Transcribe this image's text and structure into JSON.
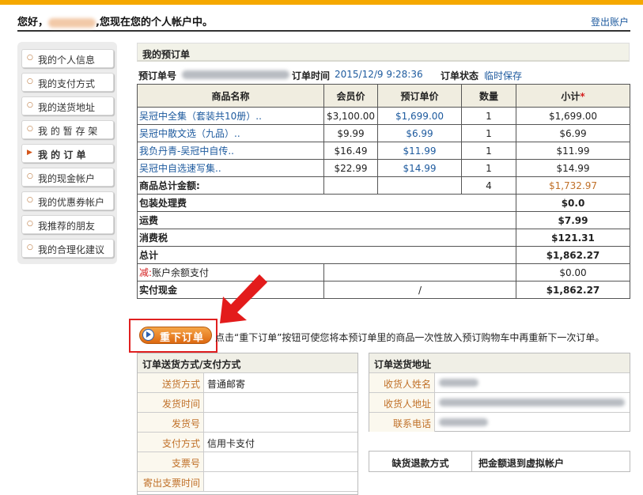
{
  "header": {
    "greeting_prefix": "您好，",
    "greeting_suffix": ",您现在您的个人帐户中。",
    "logout": "登出账户"
  },
  "sidebar": {
    "items": [
      {
        "label": "我的个人信息"
      },
      {
        "label": "我的支付方式"
      },
      {
        "label": "我的送货地址"
      },
      {
        "label": "我 的 暂 存 架"
      },
      {
        "label": "我 的 订 单",
        "active": true
      },
      {
        "label": "我的现金帐户"
      },
      {
        "label": "我的优惠券帐户"
      },
      {
        "label": "我推荐的朋友"
      },
      {
        "label": "我的合理化建议"
      }
    ]
  },
  "order": {
    "title": "我的预订单",
    "number_label": "预订单号",
    "time_label": "订单时间",
    "time_value": "2015/12/9 9:28:36",
    "status_label": "订单状态",
    "status_value": "临时保存"
  },
  "items_table": {
    "headers": [
      "商品名称",
      "会员价",
      "预订单价",
      "数量",
      "小计"
    ],
    "required_mark": "*",
    "rows": [
      {
        "name": "吴冠中全集（套装共10册）..",
        "member": "$3,100.00",
        "price": "$1,699.00",
        "qty": "1",
        "subtotal": "$1,699.00"
      },
      {
        "name": "吴冠中散文选（九品）..",
        "member": "$9.99",
        "price": "$6.99",
        "qty": "1",
        "subtotal": "$6.99"
      },
      {
        "name": "我负丹青-吴冠中自传..",
        "member": "$16.49",
        "price": "$11.99",
        "qty": "1",
        "subtotal": "$11.99"
      },
      {
        "name": "吴冠中自选速写集..",
        "member": "$22.99",
        "price": "$14.99",
        "qty": "1",
        "subtotal": "$14.99"
      }
    ],
    "goods_total_label": "商品总计金额:",
    "goods_total_qty": "4",
    "goods_total_value": "$1,732.97",
    "packing_label": "包装处理费",
    "packing_value": "$0.0",
    "shipping_label": "运费",
    "shipping_value": "$7.99",
    "tax_label": "消费税",
    "tax_value": "$121.31",
    "total_label": "总计",
    "total_value": "$1,862.27",
    "deduct_prefix": "减:",
    "deduct_label": "账户余额支付",
    "deduct_value": "$0.00",
    "cash_label": "实付现金",
    "cash_mid": "/",
    "cash_value": "$1,862.27"
  },
  "reorder": {
    "button": "重下订单",
    "hint": "点击“重下订单”按钮可使您将本预订单里的商品一次性放入预订购物车中再重新下一次订单。"
  },
  "shipping_panel": {
    "title": "订单送货方式/支付方式",
    "rows": [
      {
        "label": "送货方式",
        "value": "普通邮寄"
      },
      {
        "label": "发货时间",
        "value": ""
      },
      {
        "label": "发货号",
        "value": ""
      },
      {
        "label": "支付方式",
        "value": "信用卡支付"
      },
      {
        "label": "支票号",
        "value": ""
      },
      {
        "label": "寄出支票时间",
        "value": ""
      }
    ]
  },
  "address_panel": {
    "title": "订单送货地址",
    "rows": [
      {
        "label": "收货人姓名"
      },
      {
        "label": "收货人地址"
      },
      {
        "label": "联系电话"
      }
    ]
  },
  "refund": {
    "label": "缺货退款方式",
    "value": "把金额退到虚拟帐户"
  },
  "colors": {
    "accent": "#f5a800",
    "link": "#1d5a9e",
    "highlight_red": "#e02020",
    "button_orange": "#dd6810"
  }
}
